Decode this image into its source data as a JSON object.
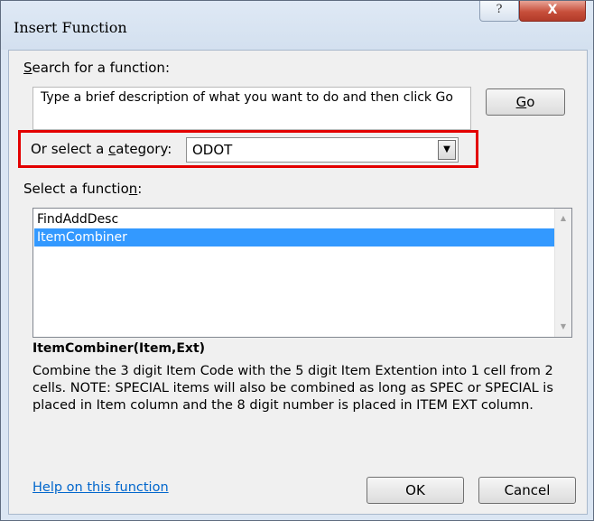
{
  "window": {
    "title": "Insert Function",
    "help_glyph": "?",
    "close_glyph": "X"
  },
  "search": {
    "label_prefix": "",
    "label_accel": "S",
    "label_rest": "earch for a function:",
    "text": "Type a brief description of what you want to do and then click Go",
    "go_accel": "G",
    "go_rest": "o"
  },
  "category": {
    "label_prefix": "Or select a ",
    "label_accel": "c",
    "label_rest": "ategory:",
    "value": "ODOT",
    "dropdown_glyph": "▼"
  },
  "functions": {
    "label_prefix": "Select a functio",
    "label_accel": "n",
    "label_rest": ":",
    "items": [
      "FindAddDesc",
      "ItemCombiner"
    ],
    "selected_index": 1
  },
  "signature": "ItemCombiner(Item,Ext)",
  "description": "Combine the 3 digit Item Code with the 5 digit Item Extention into 1 cell from 2 cells. NOTE: SPECIAL items will also be combined as long as SPEC or SPECIAL is placed in Item column and the 8 digit number is placed in ITEM EXT column.",
  "footer": {
    "help_link": "Help on this function",
    "ok_label": "OK",
    "cancel_label": "Cancel"
  },
  "colors": {
    "highlight_box": "#e30000",
    "selection": "#3399ff",
    "link": "#0066cc"
  }
}
